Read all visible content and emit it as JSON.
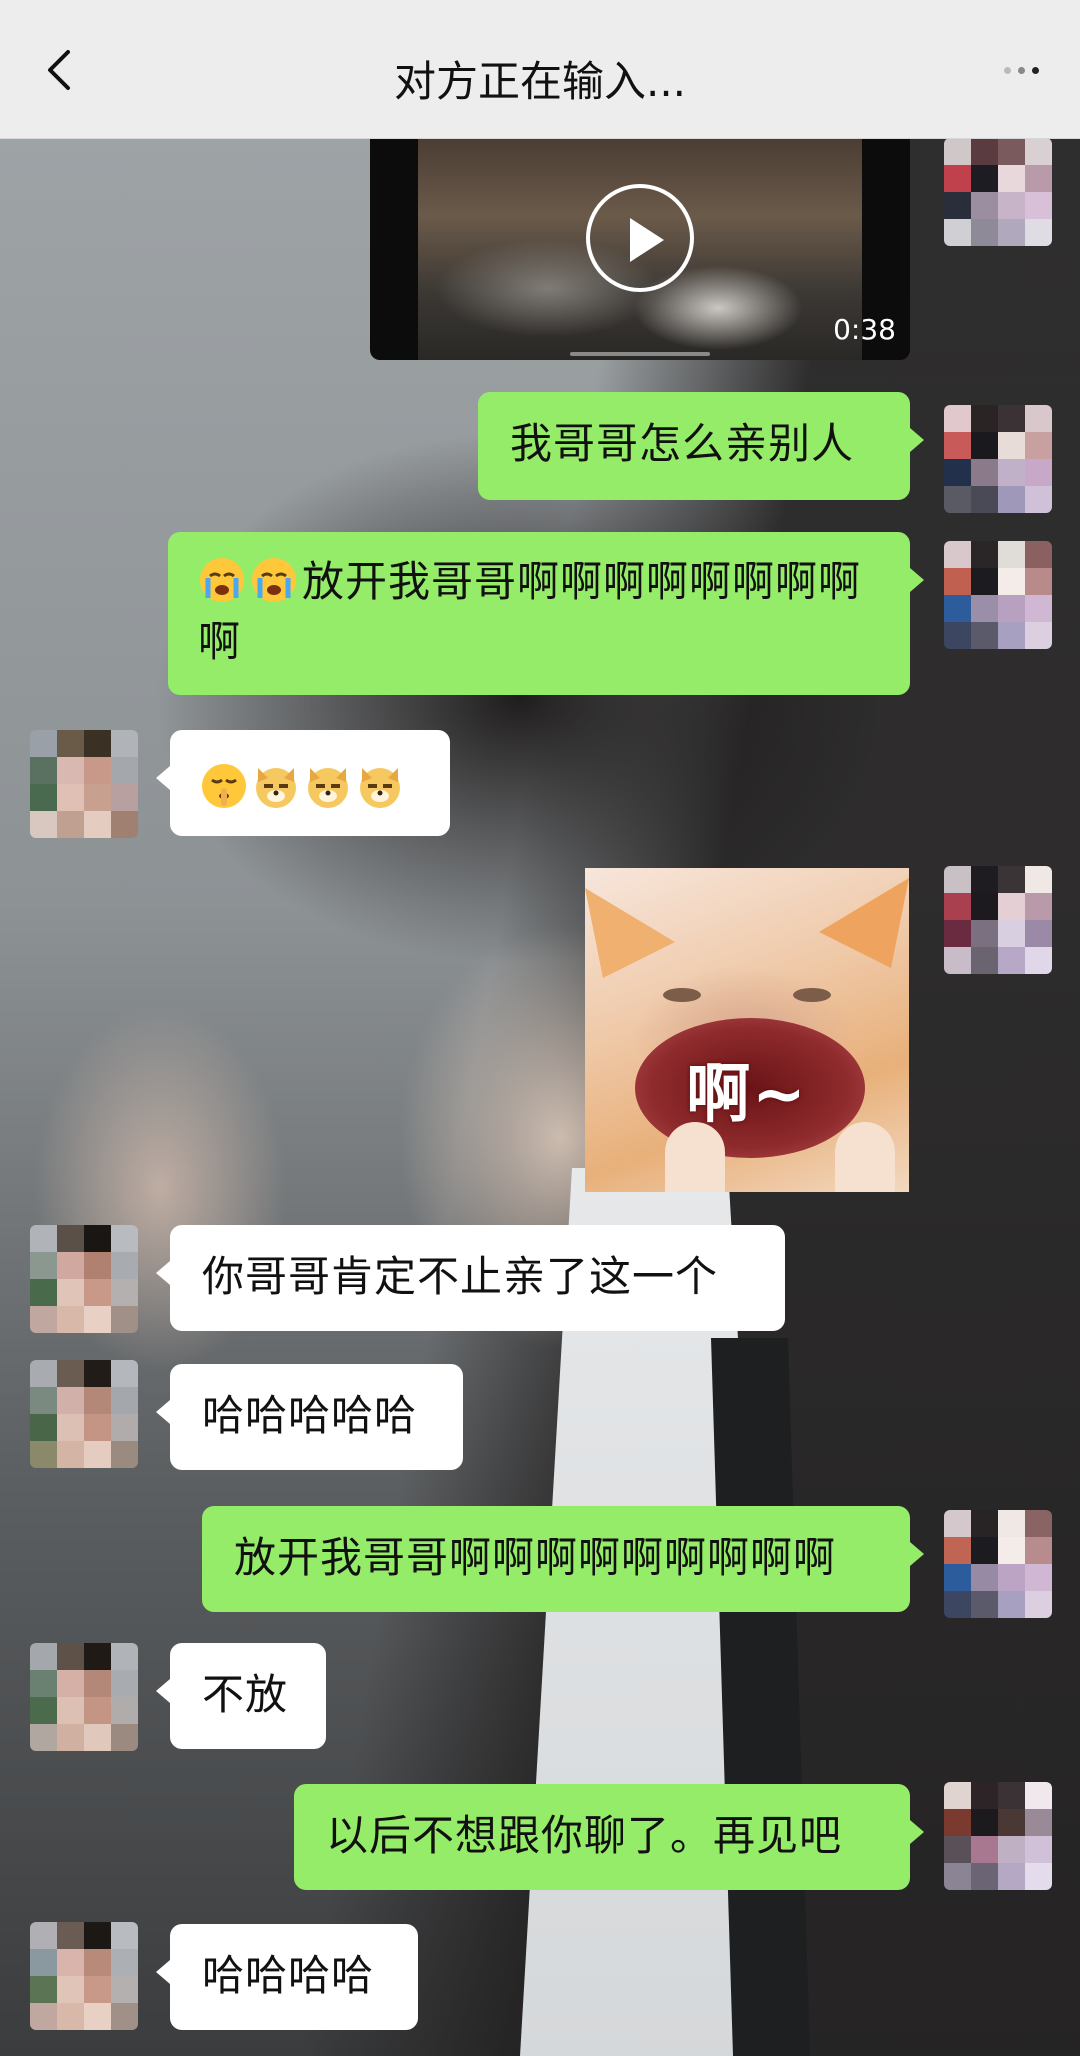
{
  "header": {
    "title": "对方正在输入..."
  },
  "video": {
    "duration": "0:38"
  },
  "sticker": {
    "text": "啊~"
  },
  "messages": [
    {
      "side": "sent",
      "text": "我哥哥怎么亲别人"
    },
    {
      "side": "sent",
      "emoji": [
        "crying-face-icon",
        "crying-face-icon"
      ],
      "text": "放开我哥哥啊啊啊啊啊啊啊啊啊"
    },
    {
      "side": "recv",
      "emoji": [
        "shushing-face-icon",
        "doge-icon",
        "doge-icon",
        "doge-icon"
      ],
      "text": ""
    },
    {
      "side": "recv",
      "text": "你哥哥肯定不止亲了这一个"
    },
    {
      "side": "recv",
      "text": "哈哈哈哈哈"
    },
    {
      "side": "sent",
      "text": "放开我哥哥啊啊啊啊啊啊啊啊啊"
    },
    {
      "side": "recv",
      "text": "不放"
    },
    {
      "side": "sent",
      "text": "以后不想跟你聊了。再见吧"
    },
    {
      "side": "recv",
      "text": "哈哈哈哈"
    }
  ]
}
